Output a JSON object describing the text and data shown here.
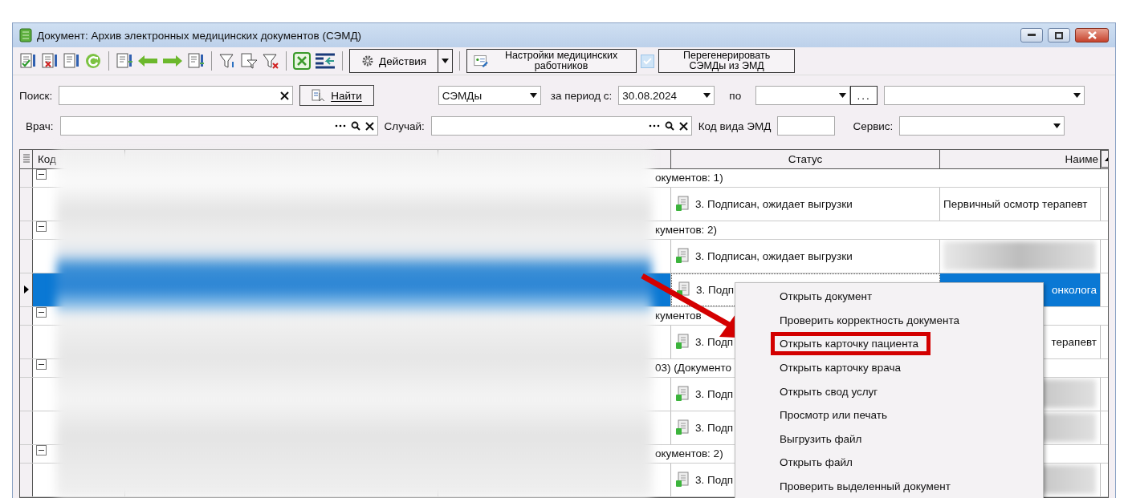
{
  "window": {
    "title": "Документ: Архив электронных медицинских документов (СЭМД)"
  },
  "toolbar": {
    "actions_button": "Действия",
    "staff_settings_button": "Настройки медицинских работников",
    "regenerate_checkbox": {
      "checked": true
    },
    "regenerate_button": "Перегенерировать СЭМДы из ЭМД"
  },
  "filters": {
    "search_label": "Поиск:",
    "find_button": "Найти",
    "doc_type": "СЭМДы",
    "period_label": "за период с:",
    "date_from": "30.08.2024",
    "to_label": "по",
    "more_button": "...",
    "doctor_label": "Врач:",
    "case_label": "Случай:",
    "emd_code_label": "Код вида ЭМД",
    "service_label": "Сервис:"
  },
  "table": {
    "columns": [
      "Код",
      "Статус",
      "Наиме"
    ],
    "rows": [
      {
        "kind": "group",
        "text": "окументов: 1)"
      },
      {
        "kind": "record",
        "status": "3. Подписан, ожидает выгрузки",
        "name": "Первичный осмотр терапевт",
        "selected": false
      },
      {
        "kind": "group",
        "text": "кументов: 2)"
      },
      {
        "kind": "record",
        "status": "3. Подписан, ожидает выгрузки",
        "selected": false
      },
      {
        "kind": "record",
        "status": "3. Подп",
        "name": "онколога",
        "selected": true
      },
      {
        "kind": "group",
        "text": "кументов"
      },
      {
        "kind": "record",
        "status": "3. Подп",
        "name": "терапевт",
        "selected": false
      },
      {
        "kind": "group",
        "text": "03) (Документо"
      },
      {
        "kind": "record",
        "status": "3. Подп",
        "selected": false
      },
      {
        "kind": "record",
        "status": "3. Подп",
        "selected": false
      },
      {
        "kind": "group",
        "text": "окументов: 2)"
      },
      {
        "kind": "record",
        "status": "3. Подп",
        "selected": false
      }
    ]
  },
  "context_menu": {
    "items": [
      {
        "label": "Открыть документ",
        "outlined": false
      },
      {
        "label": "Проверить корректность документа",
        "outlined": false
      },
      {
        "label": "Открыть карточку пациента",
        "outlined": true
      },
      {
        "label": "Открыть карточку врача",
        "outlined": false
      },
      {
        "label": "Открыть свод услуг",
        "outlined": false
      },
      {
        "label": "Просмотр или печать",
        "outlined": false
      },
      {
        "label": "Выгрузить файл",
        "outlined": false
      },
      {
        "label": "Открыть файл",
        "outlined": false
      },
      {
        "label": "Проверить выделенный документ",
        "outlined": false
      }
    ]
  }
}
